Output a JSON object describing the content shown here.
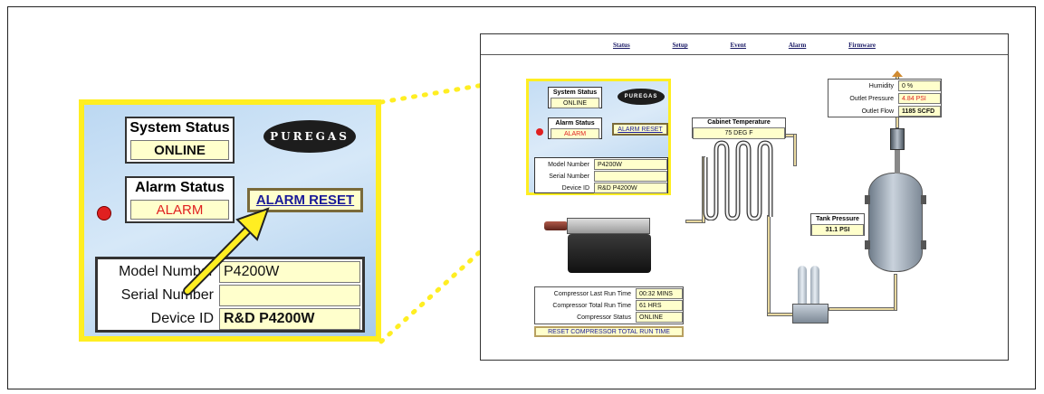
{
  "nav": {
    "status": "Status",
    "setup": "Setup",
    "event": "Event",
    "alarm": "Alarm",
    "firmware": "Firmware"
  },
  "zoom": {
    "system_status_label": "System Status",
    "system_status_value": "ONLINE",
    "logo": "PUREGAS",
    "alarm_status_label": "Alarm Status",
    "alarm_status_value": "ALARM",
    "alarm_reset": "ALARM RESET",
    "model_number_label": "Model Number",
    "model_number_value": "P4200W",
    "serial_number_label": "Serial Number",
    "serial_number_value": "",
    "device_id_label": "Device ID",
    "device_id_value": "R&D P4200W"
  },
  "mini": {
    "system_status_label": "System Status",
    "system_status_value": "ONLINE",
    "logo": "PUREGAS",
    "alarm_status_label": "Alarm Status",
    "alarm_status_value": "ALARM",
    "alarm_reset": "ALARM RESET",
    "model_number_label": "Model Number",
    "model_number_value": "P4200W",
    "serial_number_label": "Serial Number",
    "serial_number_value": "",
    "device_id_label": "Device ID",
    "device_id_value": "R&D P4200W"
  },
  "readings": {
    "humidity_label": "Humidity",
    "humidity_value": "0 %",
    "outlet_pressure_label": "Outlet Pressure",
    "outlet_pressure_value": "4.84 PSI",
    "outlet_flow_label": "Outlet Flow",
    "outlet_flow_value": "1185 SCFD"
  },
  "cabinet": {
    "label": "Cabinet Temperature",
    "value": "75 DEG F"
  },
  "tank": {
    "label": "Tank Pressure",
    "value": "31.1 PSI"
  },
  "compressor": {
    "last_run_label": "Compressor Last Run Time",
    "last_run_value": "00:32 MINS",
    "total_run_label": "Compressor Total Run Time",
    "total_run_value": "61 HRS",
    "status_label": "Compressor Status",
    "status_value": "ONLINE",
    "reset_button": "RESET COMPRESSOR TOTAL RUN TIME"
  },
  "colors": {
    "highlight": "#ffee22",
    "alarm": "#e02020",
    "field": "#ffffcc",
    "link": "#1a1a99"
  }
}
